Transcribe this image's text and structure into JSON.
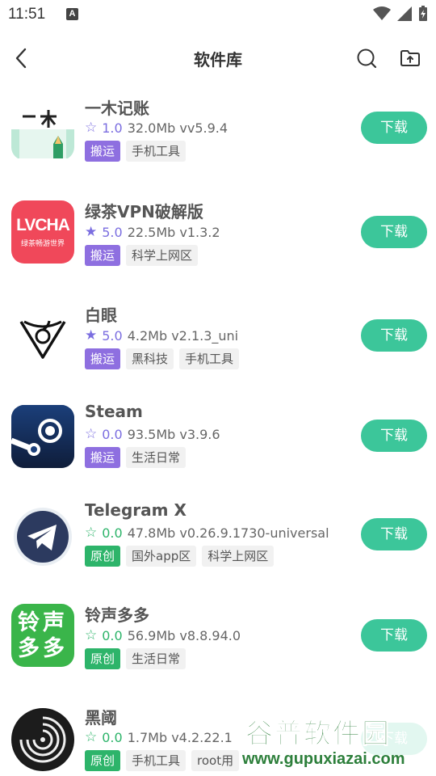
{
  "status_bar": {
    "time": "11:51",
    "notification_letter": "A"
  },
  "header": {
    "title": "软件库"
  },
  "apps": [
    {
      "name": "一木记账",
      "rating": "1.0",
      "size": "32.0Mb",
      "version": "vv5.9.4",
      "star": "hollow-star-icon",
      "source_tag": "搬运",
      "tags": [
        "手机工具"
      ],
      "download_label": "下载"
    },
    {
      "name": "绿茶VPN破解版",
      "rating": "5.0",
      "size": "22.5Mb",
      "version": "v1.3.2",
      "star": "filled-star-icon",
      "source_tag": "搬运",
      "tags": [
        "科学上网区"
      ],
      "download_label": "下载",
      "icon_text": "LVCHA",
      "icon_subtext": "绿茶畅游世界"
    },
    {
      "name": "白眼",
      "rating": "5.0",
      "size": "4.2Mb",
      "version": "v2.1.3_uni",
      "star": "filled-star-icon",
      "source_tag": "搬运",
      "tags": [
        "黑科技",
        "手机工具"
      ],
      "download_label": "下载"
    },
    {
      "name": "Steam",
      "rating": "0.0",
      "size": "93.5Mb",
      "version": "v3.9.6",
      "star": "hollow-star-icon",
      "source_tag": "搬运",
      "tags": [
        "生活日常"
      ],
      "download_label": "下载"
    },
    {
      "name": "Telegram X",
      "rating": "0.0",
      "size": "47.8Mb",
      "version": "v0.26.9.1730-universal",
      "star": "hollow-star-icon",
      "source_tag": "原创",
      "tags": [
        "国外app区",
        "科学上网区"
      ],
      "download_label": "下载"
    },
    {
      "name": "铃声多多",
      "rating": "0.0",
      "size": "56.9Mb",
      "version": "v8.8.94.0",
      "star": "hollow-star-icon",
      "source_tag": "原创",
      "tags": [
        "生活日常"
      ],
      "download_label": "下载",
      "icon_text": "铃声多多"
    },
    {
      "name": "黑阈",
      "rating": "0.0",
      "size": "1.7Mb",
      "version": "v4.2.22.1",
      "star": "hollow-star-icon",
      "source_tag": "原创",
      "tags": [
        "手机工具",
        "root用"
      ],
      "download_label": "下载"
    }
  ],
  "watermark": {
    "text": "谷普软件园",
    "url": "www.gupuxiazai.com"
  },
  "colors": {
    "download": "#3cc69a",
    "tag_transport": "#8e6fe0",
    "tag_original": "#2db46a",
    "star_transport": "#7b6ee0",
    "star_original": "#2db46a"
  }
}
